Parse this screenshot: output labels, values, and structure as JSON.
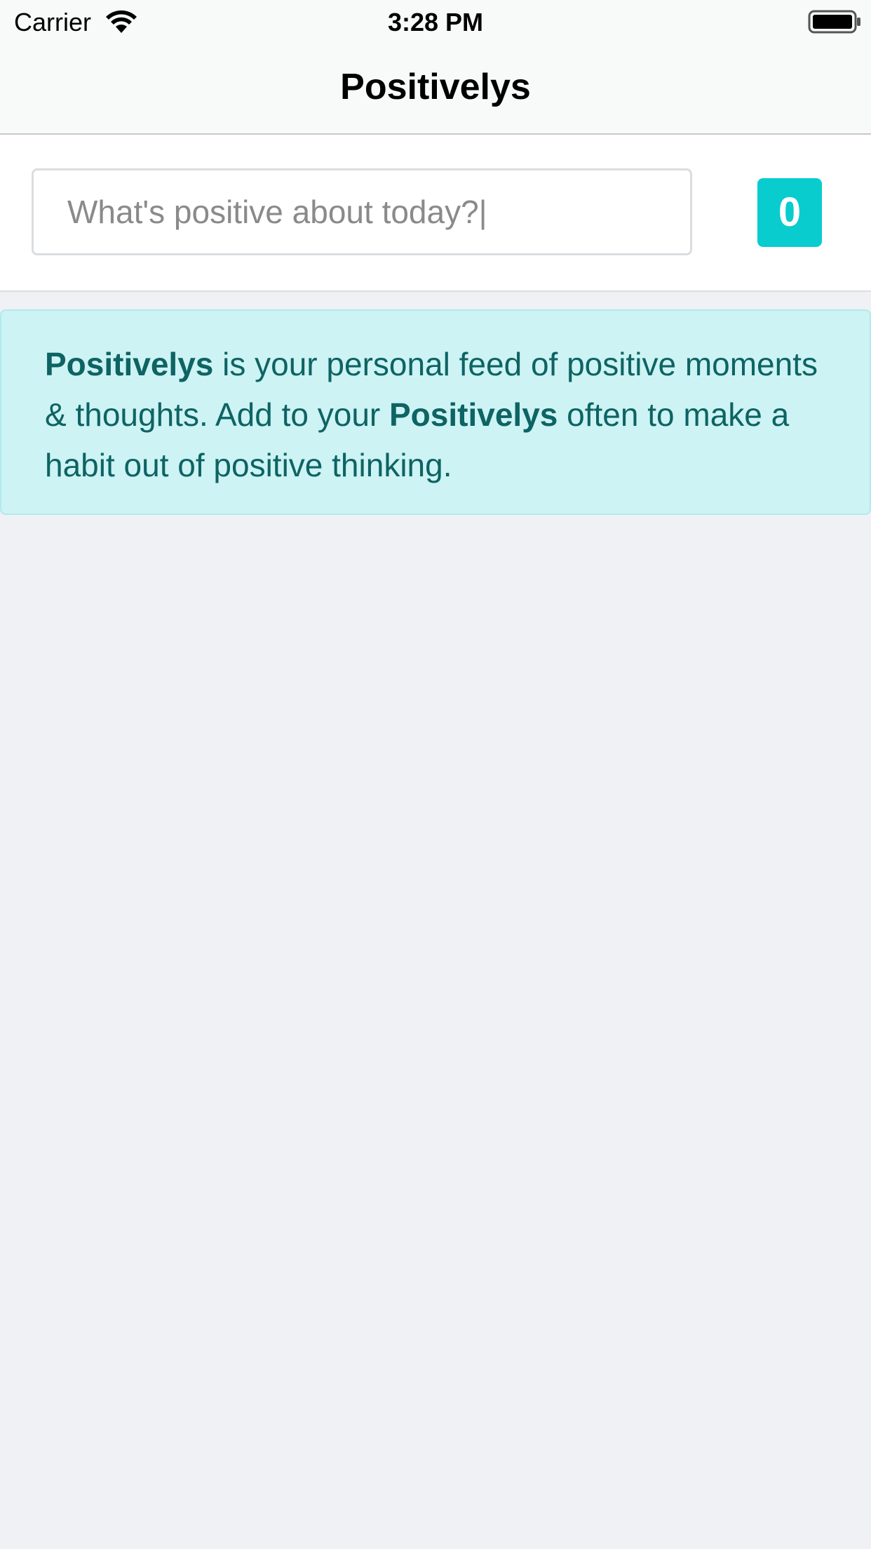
{
  "status_bar": {
    "carrier": "Carrier",
    "time": "3:28 PM",
    "icons": [
      "wifi-icon",
      "battery-icon"
    ]
  },
  "nav": {
    "title": "Positivelys"
  },
  "composer": {
    "placeholder": "What's positive about today?|",
    "count": "0"
  },
  "info": {
    "brand_1": "Positivelys",
    "text_1": " is your personal feed of positive moments & thoughts. Add to your ",
    "brand_2": "Positivelys",
    "text_2": " often to make a habit out of positive thinking."
  },
  "colors": {
    "accent": "#09ccce",
    "info_bg": "#cdf3f4",
    "info_text": "#0e6363",
    "page_bg": "#eff1f5"
  }
}
